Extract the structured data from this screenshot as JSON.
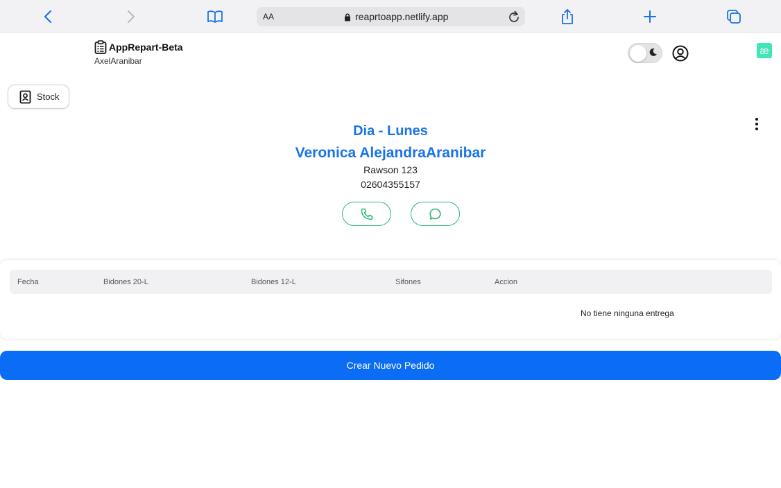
{
  "browser": {
    "text_size_label": "AA",
    "url": "reaprtoapp.netlify.app"
  },
  "app": {
    "title": "AppRepart-Beta",
    "user": "AxelAranibar",
    "ext_badge": "æ"
  },
  "stock_button": {
    "label": "Stock"
  },
  "client": {
    "day": "Dia - Lunes",
    "name": "Veronica AlejandraAranibar",
    "address": "Rawson 123",
    "phone": "02604355157"
  },
  "table": {
    "headers": [
      "Fecha",
      "Bidones 20-L",
      "Bidones 12-L",
      "Sifones",
      "Accion"
    ],
    "empty_message": "No tiene ninguna entrega"
  },
  "actions": {
    "new_order_label": "Crear Nuevo Pedido"
  },
  "colors": {
    "accent": "#1a73e8",
    "primary_button": "#0b6cf5",
    "contact_green": "#2bb673",
    "ext_badge": "#3ee6b8"
  }
}
